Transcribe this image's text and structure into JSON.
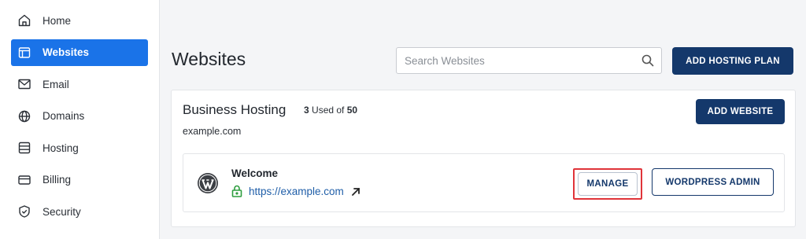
{
  "sidebar": {
    "items": [
      {
        "label": "Home",
        "icon": "home-icon",
        "active": false
      },
      {
        "label": "Websites",
        "icon": "websites-icon",
        "active": true
      },
      {
        "label": "Email",
        "icon": "email-icon",
        "active": false
      },
      {
        "label": "Domains",
        "icon": "globe-icon",
        "active": false
      },
      {
        "label": "Hosting",
        "icon": "server-icon",
        "active": false
      },
      {
        "label": "Billing",
        "icon": "credit-card-icon",
        "active": false
      },
      {
        "label": "Security",
        "icon": "shield-icon",
        "active": false
      }
    ]
  },
  "header": {
    "title": "Websites",
    "search_placeholder": "Search Websites",
    "add_hosting_label": "ADD HOSTING PLAN"
  },
  "plan": {
    "name": "Business Hosting",
    "used": "3",
    "used_of_text": "Used of",
    "total": "50",
    "domain": "example.com",
    "add_website_label": "ADD WEBSITE",
    "site": {
      "title": "Welcome",
      "url": "https://example.com",
      "manage_label": "MANAGE",
      "wp_admin_label": "WORDPRESS ADMIN"
    }
  },
  "colors": {
    "accent": "#1a73e8",
    "primary_button": "#14386b",
    "highlight": "#e0343a",
    "link": "#1f5ea8",
    "lock": "#2e9d3f"
  }
}
